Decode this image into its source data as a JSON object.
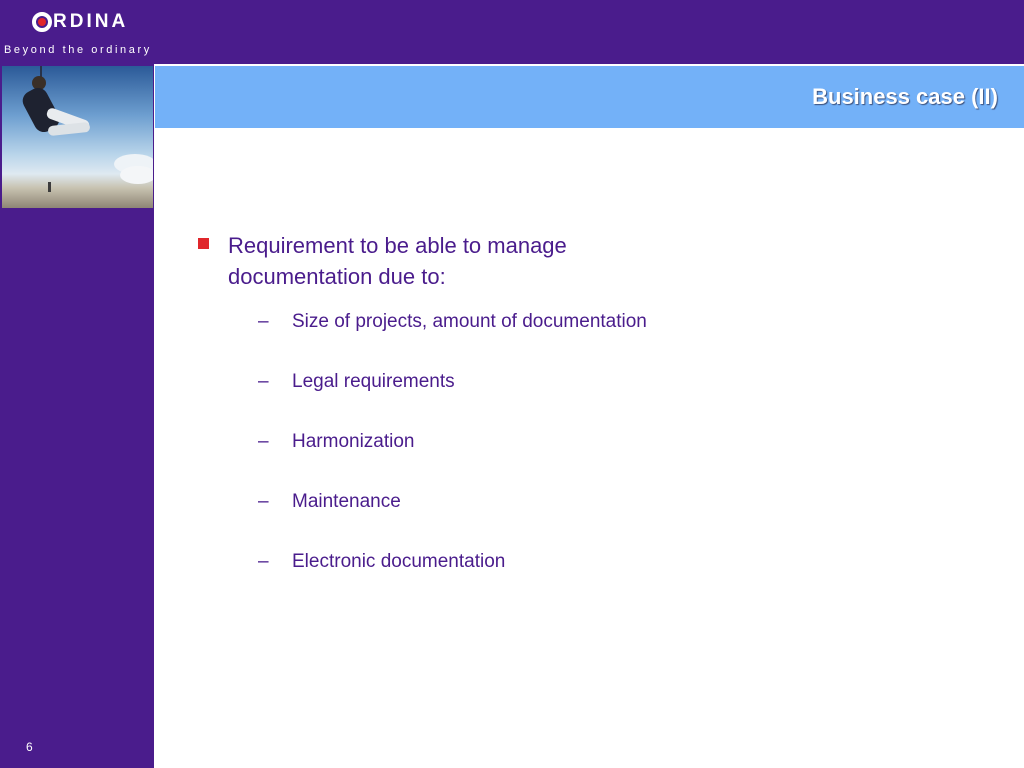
{
  "header": {
    "logo_text": "RDINA",
    "tagline": "Beyond the ordinary"
  },
  "slide": {
    "title": "Business case (II)",
    "bullet": "Requirement to be able to manage documentation due to:",
    "sub_items": [
      "Size of projects, amount of documentation",
      "Legal requirements",
      "Harmonization",
      "Maintenance",
      "Electronic documentation"
    ],
    "page_number": "6"
  },
  "colors": {
    "brand_purple": "#4a1c8c",
    "title_band": "#73b1f8",
    "accent_red": "#e0262b"
  }
}
